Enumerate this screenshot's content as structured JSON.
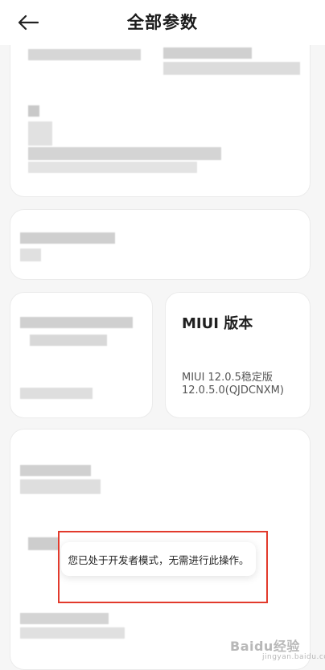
{
  "header": {
    "title": "全部参数",
    "back_icon": "arrow-left-icon"
  },
  "miui_card": {
    "title": "MIUI 版本",
    "version_line1": "MIUI 12.0.5稳定版",
    "version_line2": "12.0.5.0(QJDCNXM)"
  },
  "toast": {
    "message": "您已处于开发者模式，无需进行此操作。"
  },
  "watermark": {
    "text": "Baidu经验",
    "sub": "jingyan.baidu.com"
  },
  "colors": {
    "accent_red": "#e23a2c",
    "card_bg": "#ffffff",
    "page_bg": "#f6f6f6"
  }
}
